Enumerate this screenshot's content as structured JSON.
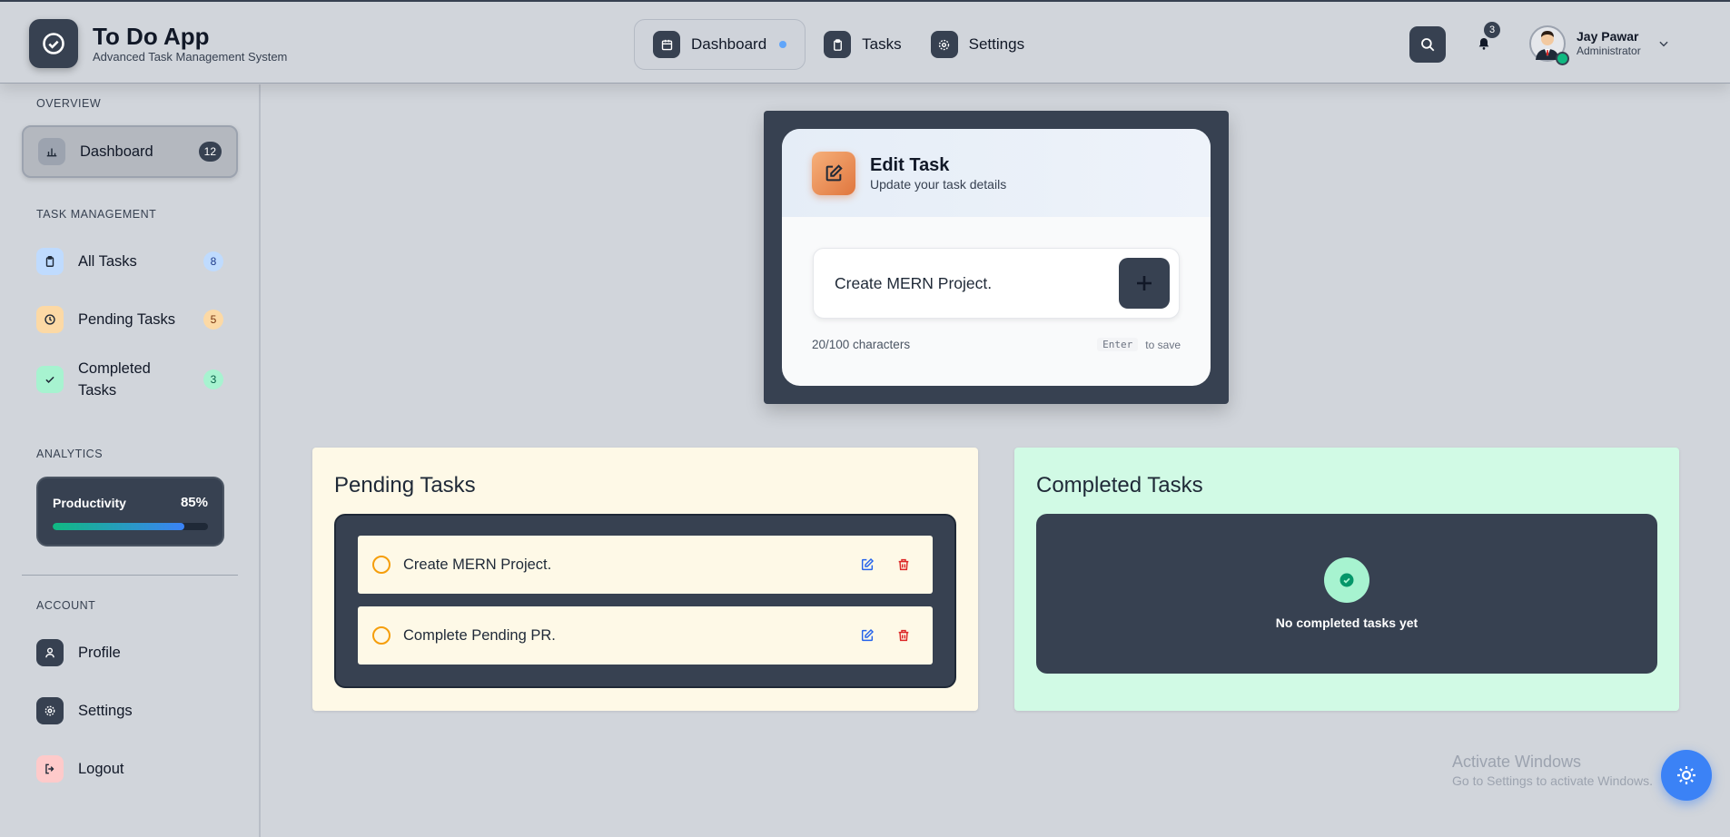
{
  "app": {
    "title": "To Do App",
    "subtitle": "Advanced Task Management System"
  },
  "topnav": {
    "items": [
      {
        "label": "Dashboard",
        "icon": "calendar-icon",
        "active": true
      },
      {
        "label": "Tasks",
        "icon": "clipboard-icon",
        "active": false
      },
      {
        "label": "Settings",
        "icon": "gear-icon",
        "active": false
      }
    ]
  },
  "header": {
    "notifications_count": "3",
    "user": {
      "name": "Jay Pawar",
      "role": "Administrator"
    }
  },
  "sidebar": {
    "overview_label": "OVERVIEW",
    "task_management_label": "TASK MANAGEMENT",
    "analytics_label": "ANALYTICS",
    "account_label": "ACCOUNT",
    "dashboard": {
      "label": "Dashboard",
      "count": "12"
    },
    "all_tasks": {
      "label": "All Tasks",
      "count": "8"
    },
    "pending_tasks": {
      "label": "Pending Tasks",
      "count": "5"
    },
    "completed_tasks": {
      "label": "Completed Tasks",
      "count": "3"
    },
    "productivity": {
      "label": "Productivity",
      "value_text": "85%",
      "value": 0.85
    },
    "profile": {
      "label": "Profile"
    },
    "settings": {
      "label": "Settings"
    },
    "logout": {
      "label": "Logout"
    }
  },
  "edit_task": {
    "title": "Edit Task",
    "subtitle": "Update your task details",
    "input_value": "Create MERN Project.",
    "char_count": "20/100 characters",
    "hint_key": "Enter",
    "hint_text": "to save"
  },
  "pending": {
    "title": "Pending Tasks",
    "tasks": [
      {
        "text": "Create MERN Project."
      },
      {
        "text": "Complete Pending PR."
      }
    ]
  },
  "completed": {
    "title": "Completed Tasks",
    "empty_text": "No completed tasks yet"
  },
  "watermark": {
    "line1": "Activate Windows",
    "line2": "Go to Settings to activate Windows."
  },
  "colors": {
    "dark": "#374151",
    "pending_bg": "#fef9e7",
    "completed_bg": "#d1fae5",
    "accent_blue": "#3b82f6",
    "accent_green": "#10b981"
  }
}
